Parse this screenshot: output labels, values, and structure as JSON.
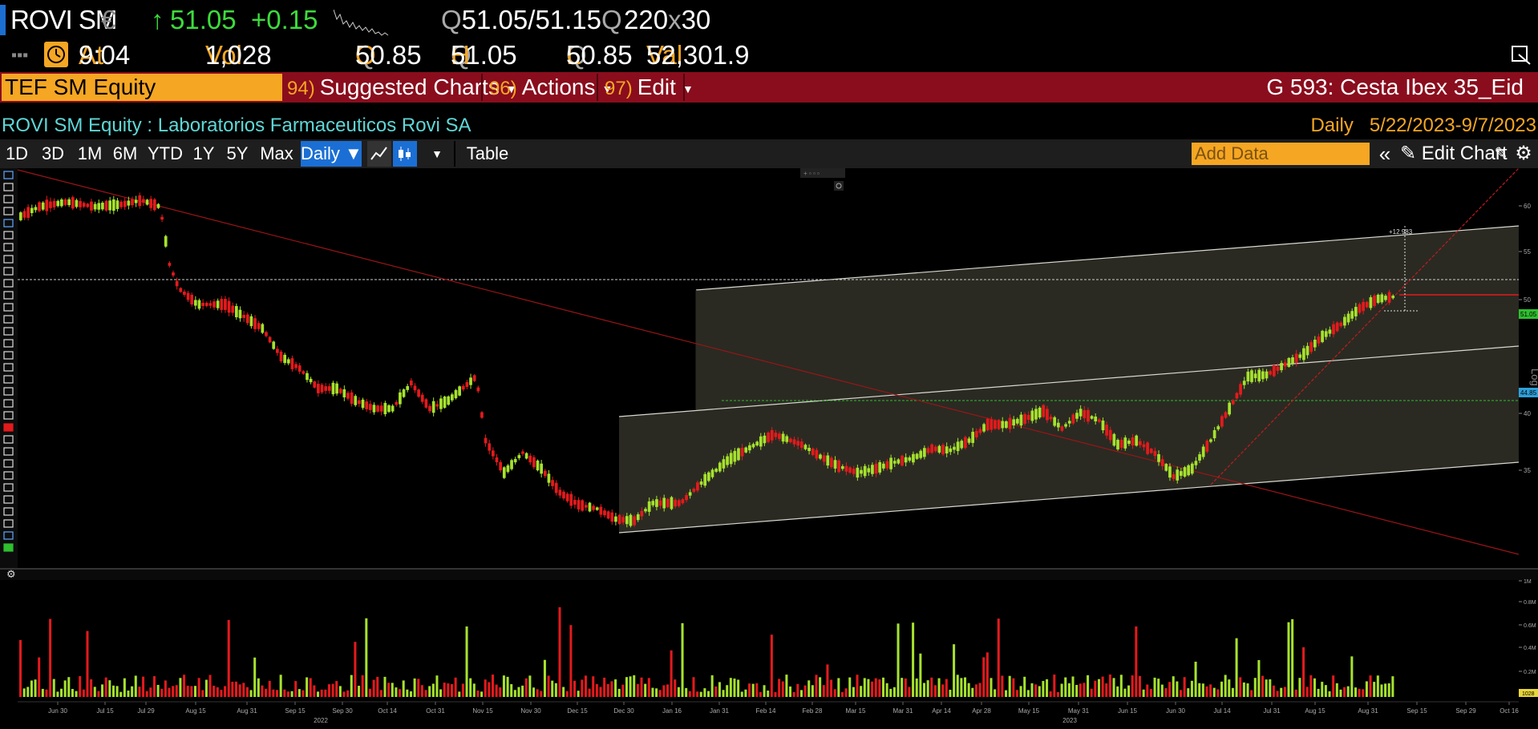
{
  "quote": {
    "ticker": "ROVI SM",
    "currency": "€",
    "direction": "↑",
    "last": "51.05",
    "change": "+0.15",
    "bid": "51.05",
    "ask": "51.15",
    "bid_ask_sep": "/",
    "q": "Q",
    "size_bid": "220",
    "size_x": "x",
    "size_ask": "30",
    "at_label": "At",
    "time": "9:04",
    "vol_label": "Vol",
    "volume": "1,028",
    "open_label": "O",
    "open": "50.85",
    "high_label": "H",
    "high": "51.05",
    "low_label": "L",
    "low": "50.85",
    "val_label": "Val",
    "value": "52,301.9"
  },
  "command_bar": {
    "security": "TEF SM Equity",
    "menus": [
      {
        "num": "94)",
        "label": "Suggested Charts"
      },
      {
        "num": "96)",
        "label": "Actions"
      },
      {
        "num": "97)",
        "label": "Edit"
      }
    ],
    "group": "G 593: Cesta Ibex 35_Eid"
  },
  "title": {
    "security_name": "ROVI SM Equity : Laboratorios Farmaceuticos Rovi SA",
    "frequency": "Daily",
    "range": "5/22/2023-9/7/2023"
  },
  "toolbar": {
    "periods": [
      "1D",
      "3D",
      "1M",
      "6M",
      "YTD",
      "1Y",
      "5Y",
      "Max"
    ],
    "frequency_button": "Daily ▼",
    "table_label": "Table",
    "add_data_placeholder": "Add Data",
    "collapse": "«",
    "edit_chart": "Edit Chart"
  },
  "chart_data": {
    "type": "candlestick",
    "y_axis_ticks": [
      "60",
      "55",
      "50",
      "40",
      "35"
    ],
    "y_axis_scale": "Log",
    "price_labels": [
      "51.05",
      "44.85"
    ],
    "annotation": "+12.983",
    "x_axis_ticks": [
      "Jun 30",
      "Jul 15",
      "Jul 29",
      "Aug 15",
      "Aug 31",
      "Sep 15",
      "Sep 30",
      "Oct 14",
      "Oct 31",
      "Nov 15",
      "Nov 30",
      "Dec 15",
      "Dec 30",
      "Jan 16",
      "Jan 31",
      "Feb 14",
      "Feb 28",
      "Mar 15",
      "Mar 31",
      "Apr 14",
      "Apr 28",
      "May 15",
      "May 31",
      "Jun 15",
      "Jun 30",
      "Jul 14",
      "Jul 31",
      "Aug 15",
      "Aug 31",
      "Sep 15",
      "Sep 29",
      "Oct 16"
    ],
    "year_labels": [
      "2022",
      "2023"
    ],
    "volume_ticks": [
      "1M",
      "0.8M",
      "0.6M",
      "0.4M",
      "0.2M"
    ],
    "volume_label": "1028",
    "colors": {
      "up": "#a6e22e",
      "down": "#e31a1c",
      "channel": "#dddddd",
      "trend": "#b0191e"
    }
  }
}
